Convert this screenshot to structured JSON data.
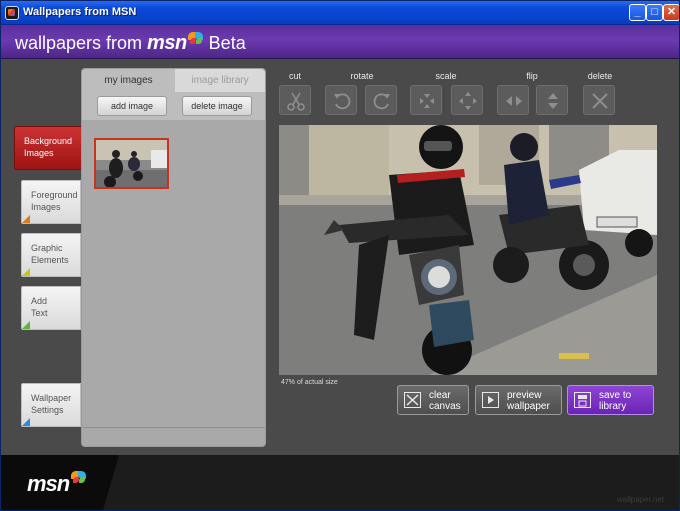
{
  "window": {
    "title": "Wallpapers from MSN",
    "controls": {
      "minimize": "_",
      "maximize": "□",
      "close": "✕"
    }
  },
  "header": {
    "prefix": "wallpapers from ",
    "brand": "msn",
    "suffix": " Beta"
  },
  "side_tabs": [
    {
      "line1": "Background",
      "line2": "Images",
      "active": true
    },
    {
      "line1": "Foreground",
      "line2": "Images",
      "active": false
    },
    {
      "line1": "Graphic",
      "line2": "Elements",
      "active": false
    },
    {
      "line1": "Add",
      "line2": "Text",
      "active": false
    },
    {
      "line1": "Wallpaper",
      "line2": "Settings",
      "active": false
    }
  ],
  "image_panel": {
    "tab_my_images": "my images",
    "tab_image_library": "image library",
    "add_image": "add image",
    "delete_image": "delete image"
  },
  "tools": {
    "cut": "cut",
    "rotate": "rotate",
    "scale": "scale",
    "flip": "flip",
    "delete": "delete"
  },
  "canvas": {
    "caption": "47% of actual size"
  },
  "actions": {
    "clear_canvas": [
      "clear",
      "canvas"
    ],
    "preview_wallpaper": [
      "preview",
      "wallpaper"
    ],
    "save_to_library": [
      "save to",
      "library"
    ]
  },
  "footer": {
    "brand": "msn",
    "watermark": "wallpaper.net"
  },
  "colors": {
    "header_purple": "#5a2f9a",
    "active_tab_red": "#b51e1e",
    "save_purple": "#7a33c4"
  }
}
